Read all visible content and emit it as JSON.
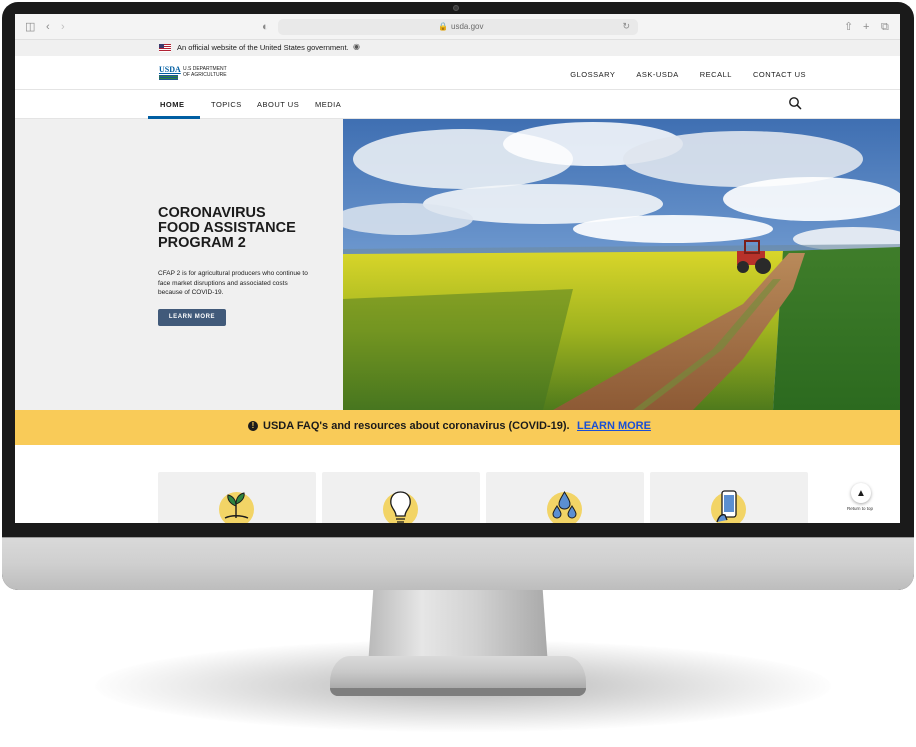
{
  "browser": {
    "url": "usda.gov",
    "icons": [
      "sidebar-icon",
      "back-icon",
      "forward-icon",
      "privacy-icon",
      "lock-icon",
      "reload-icon",
      "share-icon",
      "new-tab-icon",
      "tabs-icon"
    ]
  },
  "gov_banner": {
    "text": "An official website of the United States government."
  },
  "logo": {
    "abbr": "USDA",
    "line1": "U.S DEPARTMENT",
    "line2": "OF AGRICULTURE"
  },
  "top_nav": [
    "GLOSSARY",
    "ASK-USDA",
    "RECALL",
    "CONTACT US"
  ],
  "main_nav": {
    "items": [
      "HOME",
      "TOPICS",
      "ABOUT US",
      "MEDIA"
    ],
    "active": "HOME"
  },
  "hero": {
    "title": "CORONAVIRUS FOOD ASSISTANCE PROGRAM 2",
    "description": "CFAP 2 is for agricultural producers who continue to face market disruptions and associated costs because of COVID-19.",
    "button_label": "LEARN MORE"
  },
  "alert": {
    "message": "USDA FAQ's and resources about coronavirus (COVID-19).",
    "link_label": "LEARN MORE"
  },
  "cards": [
    {
      "icon": "seedling-hand-icon"
    },
    {
      "icon": "lightbulb-icon"
    },
    {
      "icon": "water-drops-icon"
    },
    {
      "icon": "mobile-phone-icon"
    }
  ],
  "return_to_top": "Return to top",
  "colors": {
    "usda_blue": "#005ea2",
    "alert_yellow": "#f9cb58",
    "button_navy": "#415a7a",
    "link_blue": "#1a4fd6"
  }
}
